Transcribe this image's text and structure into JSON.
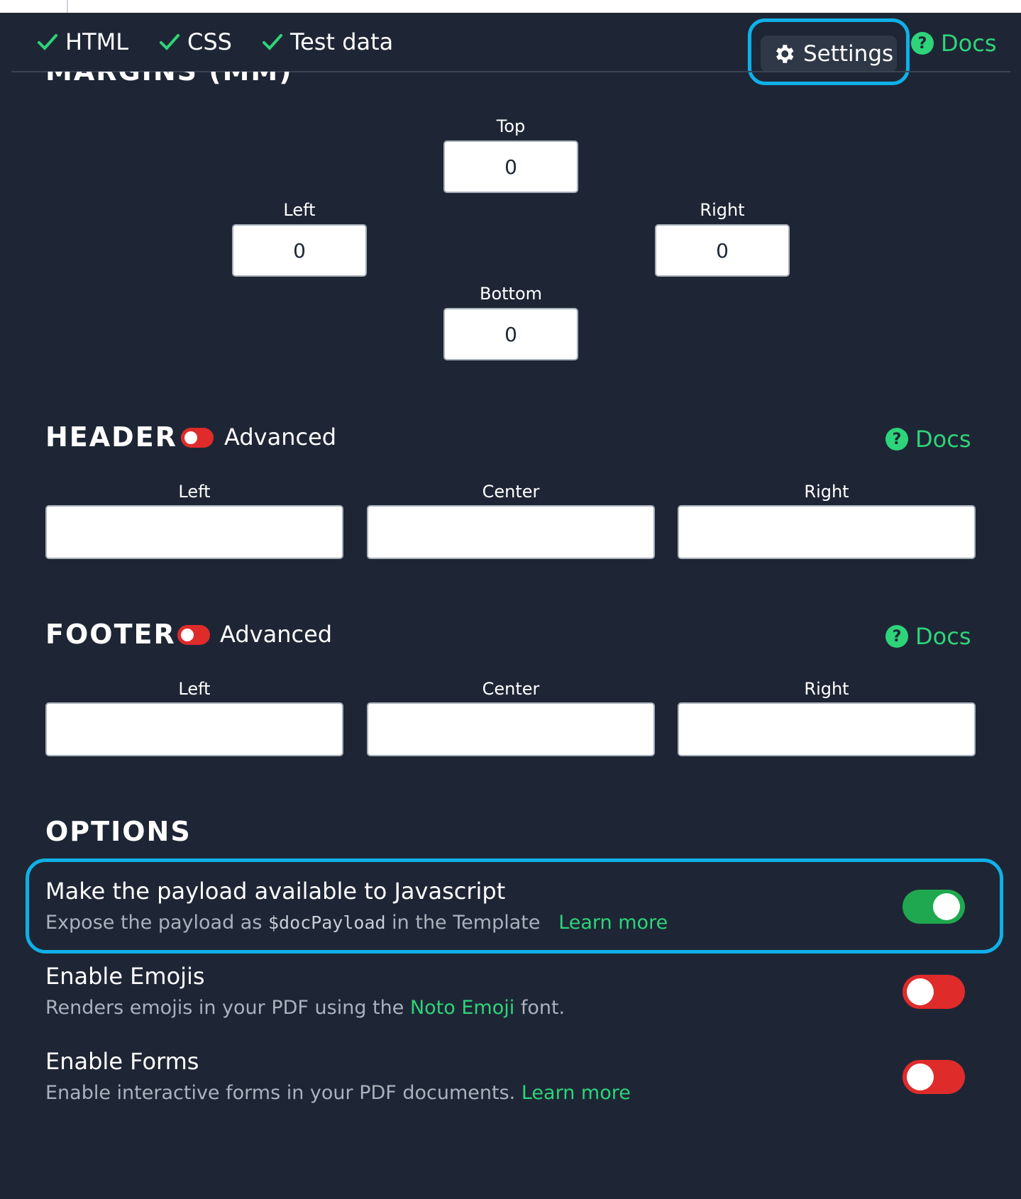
{
  "tabs": [
    {
      "label": "HTML",
      "status": "complete"
    },
    {
      "label": "CSS",
      "status": "complete"
    },
    {
      "label": "Test data",
      "status": "complete"
    }
  ],
  "toolbar": {
    "settings_label": "Settings",
    "docs_label": "Docs"
  },
  "margins": {
    "heading": "MARGINS (MM)",
    "top": {
      "label": "Top",
      "value": "0"
    },
    "left": {
      "label": "Left",
      "value": "0"
    },
    "right": {
      "label": "Right",
      "value": "0"
    },
    "bottom": {
      "label": "Bottom",
      "value": "0"
    }
  },
  "header": {
    "title": "HEADER",
    "advanced_label": "Advanced",
    "advanced_on": false,
    "docs_label": "Docs",
    "fields": {
      "left": "Left",
      "center": "Center",
      "right": "Right"
    }
  },
  "footer": {
    "title": "FOOTER",
    "advanced_label": "Advanced",
    "advanced_on": false,
    "docs_label": "Docs",
    "fields": {
      "left": "Left",
      "center": "Center",
      "right": "Right"
    }
  },
  "options": {
    "title": "OPTIONS",
    "items": [
      {
        "title": "Make the payload available to Javascript",
        "desc_pre": "Expose the payload as ",
        "desc_code": "$docPayload",
        "desc_post": " in the Template",
        "link": "Learn more",
        "enabled": true
      },
      {
        "title": "Enable Emojis",
        "desc_pre": "Renders emojis in your PDF using the ",
        "link": "Noto Emoji",
        "desc_post": " font.",
        "enabled": false
      },
      {
        "title": "Enable Forms",
        "desc_pre": "Enable interactive forms in your PDF documents. ",
        "link": "Learn more",
        "enabled": false
      }
    ]
  },
  "colors": {
    "background": "#1e2635",
    "accent_green": "#2ed47a",
    "toggle_off": "#e02b2b",
    "toggle_on": "#1fa84f",
    "highlight": "#0fb0e8"
  }
}
